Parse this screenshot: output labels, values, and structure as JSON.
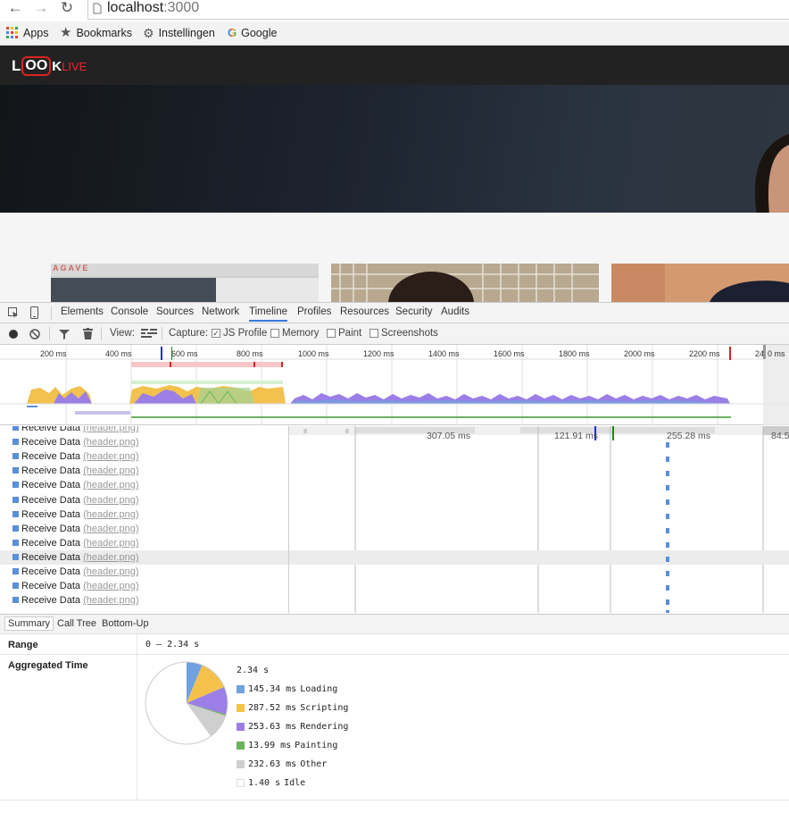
{
  "browser": {
    "back_icon": "arrow-left-icon",
    "forward_icon": "arrow-right-icon",
    "reload_icon": "reload-icon",
    "url_host": "localhost",
    "url_port": ":3000",
    "bookmarks": {
      "apps": "Apps",
      "bookmarks": "Bookmarks",
      "instellingen": "Instellingen",
      "google": "Google"
    }
  },
  "site": {
    "logo_left": "L",
    "logo_oo": "OO",
    "logo_k": "K",
    "logo_live": "LIVE",
    "thumb1_sign": "AGAVE"
  },
  "devtools": {
    "tabs": [
      "Elements",
      "Console",
      "Sources",
      "Network",
      "Timeline",
      "Profiles",
      "Resources",
      "Security",
      "Audits"
    ],
    "active_tab": "Timeline",
    "toolbar": {
      "view_label": "View:",
      "capture_label": "Capture:",
      "js_profile": "JS Profile",
      "memory": "Memory",
      "paint": "Paint",
      "screenshots": "Screenshots"
    },
    "ruler": [
      "200 ms",
      "400 ms",
      "600 ms",
      "800 ms",
      "1000 ms",
      "1200 ms",
      "1400 ms",
      "1600 ms",
      "1800 ms",
      "2000 ms",
      "2200 ms",
      "24",
      "0 ms"
    ],
    "flame_durations": [
      "307.05 ms",
      "121.91 ms",
      "255.28 ms",
      "84.5"
    ],
    "events": {
      "name": "Receive Data",
      "file": "(header.png)",
      "count": 13
    },
    "bottom_tabs": [
      "Summary",
      "Call Tree",
      "Bottom-Up"
    ],
    "summary": {
      "range_label": "Range",
      "range_value": "0 – 2.34 s",
      "aggregated_label": "Aggregated Time",
      "total": "2.34 s",
      "rows": [
        {
          "value": "145.34 ms",
          "name": "Loading",
          "color": "#6fa2e0"
        },
        {
          "value": "287.52 ms",
          "name": "Scripting",
          "color": "#f4c24a"
        },
        {
          "value": "253.63 ms",
          "name": "Rendering",
          "color": "#9b7fe6"
        },
        {
          "value": "13.99 ms",
          "name": "Painting",
          "color": "#6cb35e"
        },
        {
          "value": "232.63 ms",
          "name": "Other",
          "color": "#cfcfcf"
        },
        {
          "value": "1.40 s",
          "name": "Idle",
          "color": "#ffffff"
        }
      ]
    }
  }
}
